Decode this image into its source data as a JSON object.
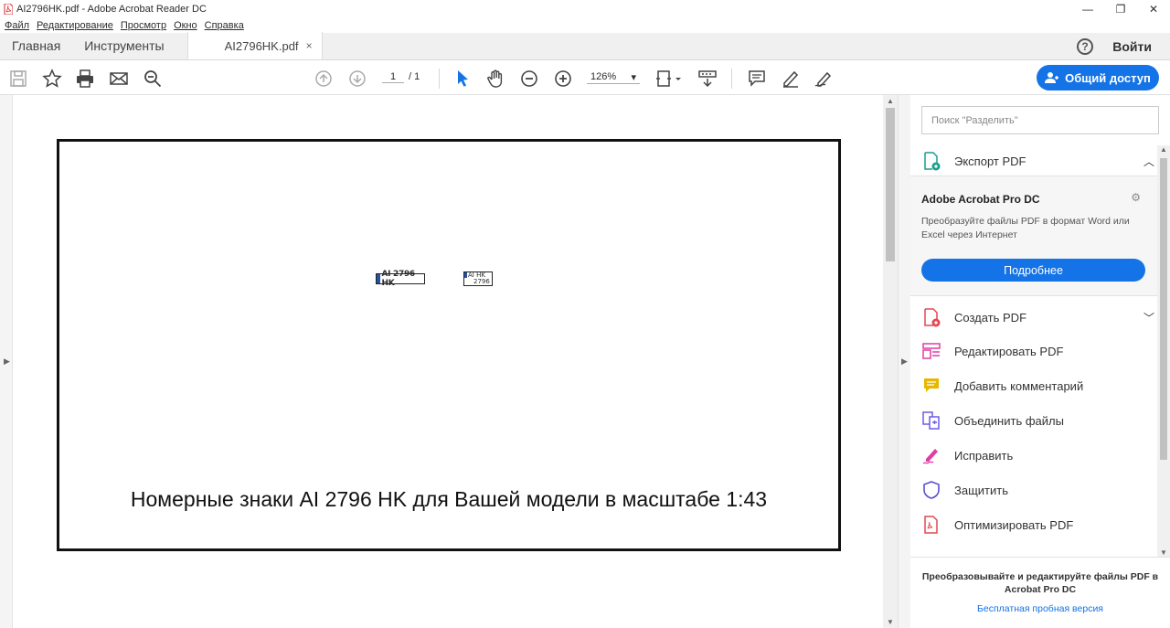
{
  "window": {
    "title": "AI2796HK.pdf - Adobe Acrobat Reader DC",
    "minimize": "—",
    "restore": "❐",
    "close": "✕"
  },
  "menu": [
    "Файл",
    "Редактирование",
    "Просмотр",
    "Окно",
    "Справка"
  ],
  "tabs": {
    "home": "Главная",
    "tools": "Инструменты",
    "doc": "AI2796HK.pdf",
    "doc_close": "×"
  },
  "header": {
    "help": "?",
    "login": "Войти"
  },
  "toolbar": {
    "page_current": "1",
    "page_total": "/ 1",
    "zoom": "126%",
    "zoom_caret": "▾",
    "share_label": "Общий доступ",
    "icons": [
      "save-icon",
      "bookmark-star-icon",
      "print-icon",
      "email-icon",
      "search-zoom-icon",
      "prev-page-icon",
      "next-page-icon",
      "select-cursor-icon",
      "hand-icon",
      "zoom-out-icon",
      "zoom-in-icon",
      "fit-page-icon",
      "scroll-mode-icon",
      "comment-icon",
      "highlight-pen-icon",
      "sign-icon"
    ]
  },
  "document": {
    "plate_long": "AI 2796 HK",
    "plate_square_line1": "AI  HK",
    "plate_square_line2": "2796",
    "caption": "Номерные знаки AI 2796 HK для Вашей модели в масштабе 1:43"
  },
  "pane": {
    "search_placeholder": "Поиск \"Разделить\"",
    "export_label": "Экспорт PDF",
    "promo_title": "Adobe Acrobat Pro DC",
    "promo_text": "Преобразуйте файлы PDF в формат Word или Excel через Интернет",
    "promo_button": "Подробнее",
    "tools": [
      {
        "label": "Создать PDF",
        "color": "#e34850"
      },
      {
        "label": "Редактировать PDF",
        "color": "#e03ea0"
      },
      {
        "label": "Добавить комментарий",
        "color": "#e6b800"
      },
      {
        "label": "Объединить файлы",
        "color": "#6c5ce7"
      },
      {
        "label": "Исправить",
        "color": "#e03ea0"
      },
      {
        "label": "Защитить",
        "color": "#5a4fcf"
      },
      {
        "label": "Оптимизировать PDF",
        "color": "#e34850"
      }
    ],
    "bottom_text": "Преобразовывайте и редактируйте файлы PDF в Acrobat Pro DC",
    "bottom_link": "Бесплатная пробная версия"
  },
  "colors": {
    "accent": "#1473e6",
    "plate_flag": "#2453a6"
  }
}
